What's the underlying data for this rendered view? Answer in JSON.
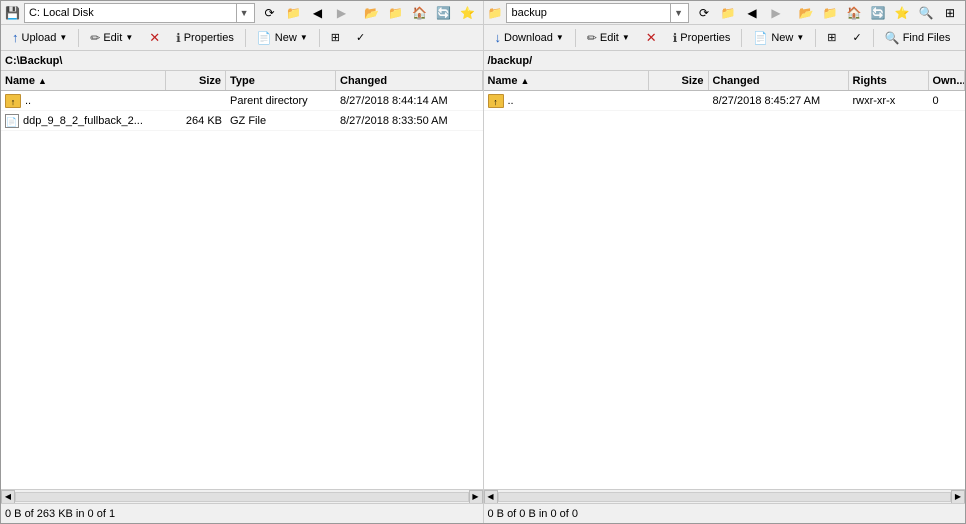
{
  "left": {
    "location": "C: Local Disk",
    "path": "C:\\Backup\\",
    "status": "0 B of 263 KB in 0 of 1",
    "columns": {
      "name": "Name",
      "size": "Size",
      "type": "Type",
      "changed": "Changed"
    },
    "files": [
      {
        "name": "..",
        "display": "..",
        "size": "",
        "type": "Parent directory",
        "changed": "8/27/2018  8:44:14 AM",
        "icon": "parent"
      },
      {
        "name": "ddp_9_8_2_fullback_2...",
        "display": "ddp_9_8_2_fullback_2...",
        "size": "264 KB",
        "type": "GZ File",
        "changed": "8/27/2018  8:33:50 AM",
        "icon": "file"
      }
    ]
  },
  "right": {
    "location": "backup",
    "path": "/backup/",
    "status": "0 B of 0 B in 0 of 0",
    "columns": {
      "name": "Name",
      "size": "Size",
      "changed": "Changed",
      "rights": "Rights",
      "owner": "Own..."
    },
    "files": [
      {
        "name": "..",
        "display": "..",
        "size": "",
        "changed": "8/27/2018  8:45:27 AM",
        "rights": "rwxr-xr-x",
        "owner": "0",
        "icon": "parent"
      }
    ]
  },
  "toolbar_left": {
    "upload": "Upload",
    "edit": "Edit",
    "delete_label": "",
    "properties": "Properties",
    "new": "New"
  },
  "toolbar_right": {
    "download": "Download",
    "edit": "Edit",
    "delete_label": "",
    "properties": "Properties",
    "new": "New",
    "find_files": "Find Files"
  }
}
